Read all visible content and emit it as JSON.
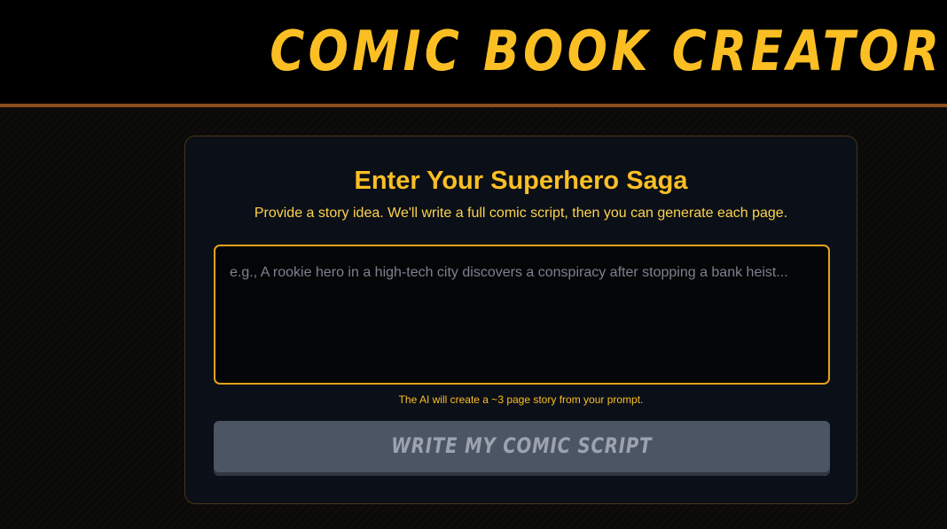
{
  "header": {
    "title": "Comic Book Creator"
  },
  "card": {
    "title": "Enter Your Superhero Saga",
    "subtitle": "Provide a story idea. We'll write a full comic script, then you can generate each page.",
    "prompt": {
      "placeholder": "e.g., A rookie hero in a high-tech city discovers a conspiracy after stopping a bank heist...",
      "value": ""
    },
    "helper_text": "The AI will create a ~3 page story from your prompt.",
    "button_label": "Write My Comic Script",
    "button_state": "disabled"
  },
  "colors": {
    "accent": "#fbbf24",
    "header_border": "#8a4d1c",
    "input_border": "#e3a21a",
    "button_bg": "#4b5563",
    "button_text": "#9ca3af",
    "card_bg": "#0b0f17"
  }
}
